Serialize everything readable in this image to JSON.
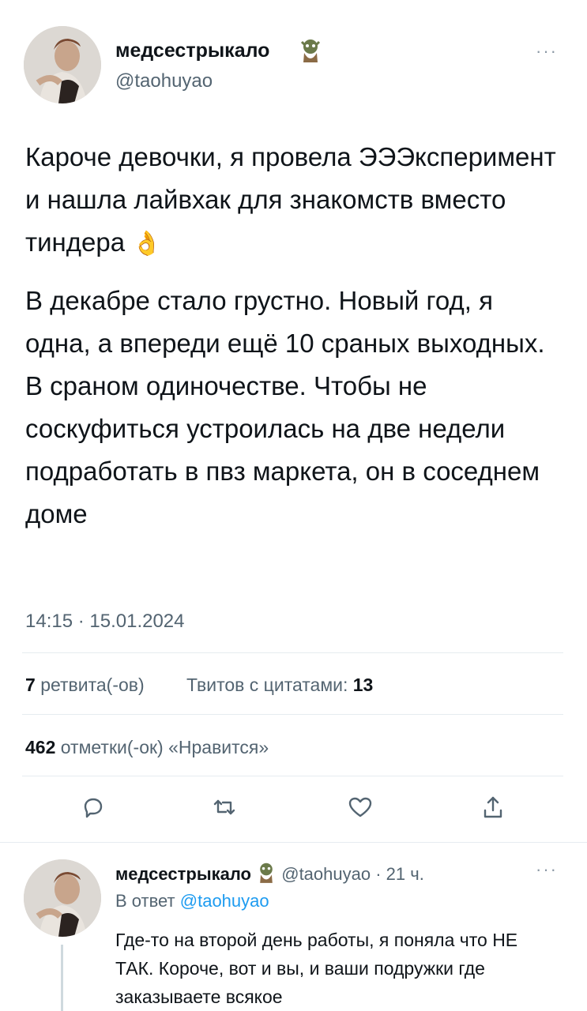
{
  "main_tweet": {
    "author_name": "медсестрыкало",
    "author_handle": "@taohuyao",
    "author_badge_icon": "troll-emoji-icon",
    "more_label": "···",
    "paragraph_1": "Кароче девочки, я провела ЭЭЭксперимент и нашла лайвхак для знакомств вместо тиндера",
    "paragraph_1_emoji": "👌",
    "paragraph_2": "В декабре стало грустно. Новый год, я одна, а впереди ещё 10 сраных выходных. В сраном одиночестве. Чтобы не соскуфиться устроилась на две недели подработать в пвз маркета, он в соседнем доме",
    "timestamp": "14:15 · 15.01.2024"
  },
  "stats": {
    "retweets_count": "7",
    "retweets_label": "ретвита(-ов)",
    "quotes_label": "Твитов с цитатами:",
    "quotes_count": "13",
    "likes_count": "462",
    "likes_label": "отметки(-ок) «Нравится»"
  },
  "actions": [
    {
      "name": "reply-button",
      "icon": "reply-icon"
    },
    {
      "name": "retweet-button",
      "icon": "retweet-icon"
    },
    {
      "name": "like-button",
      "icon": "heart-icon"
    },
    {
      "name": "share-button",
      "icon": "share-icon"
    }
  ],
  "reply_tweet": {
    "author_name": "медсестрыкало",
    "author_handle": "@taohuyao",
    "time": "· 21 ч.",
    "more_label": "···",
    "reply_to_prefix": "В ответ",
    "reply_to_handle": "@taohuyao",
    "text": "Где-то на второй день работы, я поняла что НЕ ТАК. Короче, вот и вы, и ваши подружки где заказываете всякое"
  },
  "colors": {
    "accent": "#1d9bf0",
    "text": "#0f1419",
    "muted": "#536471",
    "divider": "#e6ecf0"
  }
}
